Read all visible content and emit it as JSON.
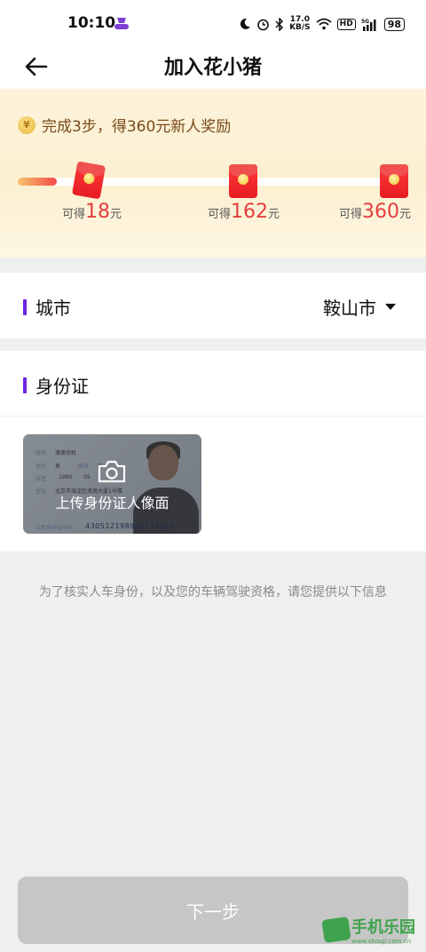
{
  "status_bar": {
    "time": "10:10",
    "net_speed_value": "17.0",
    "net_speed_unit": "KB/S",
    "hd_badge": "HD",
    "signal_label": "5G",
    "battery": "98"
  },
  "header": {
    "title": "加入花小猪"
  },
  "reward": {
    "headline": "完成3步，得360元新人奖励",
    "progress_fraction": 0.1,
    "steps": [
      {
        "prefix": "可得",
        "amount": "18",
        "unit": "元"
      },
      {
        "prefix": "可得",
        "amount": "162",
        "unit": "元"
      },
      {
        "prefix": "可得",
        "amount": "360",
        "unit": "元"
      }
    ]
  },
  "city": {
    "label": "城市",
    "value": "鞍山市"
  },
  "id_section": {
    "label": "身份证",
    "card": {
      "upload_label": "上传身份证人像面",
      "name_key": "姓名",
      "name_value": "滴滴司机",
      "sex_key": "性别",
      "sex_value": "男",
      "nation_key": "民族",
      "nation_value": "汉",
      "birth_key": "出生",
      "birth_year": "1980",
      "birth_month": "05",
      "address_key": "住址",
      "address_value": "北京市海淀区滴滴大厦1号楼",
      "id_key": "公民身份证号码",
      "id_value": "430512198908131367"
    }
  },
  "hint": "为了核实人车身份，以及您的车辆驾驶资格，请您提供以下信息",
  "next_button": "下一步",
  "watermark": {
    "text": "手机乐园",
    "url": "www.shouji.com.cn"
  },
  "colors": {
    "accent_bar": "#6d24e3",
    "reward_red": "#e43e3e",
    "button_disabled": "#c6c6c6"
  }
}
